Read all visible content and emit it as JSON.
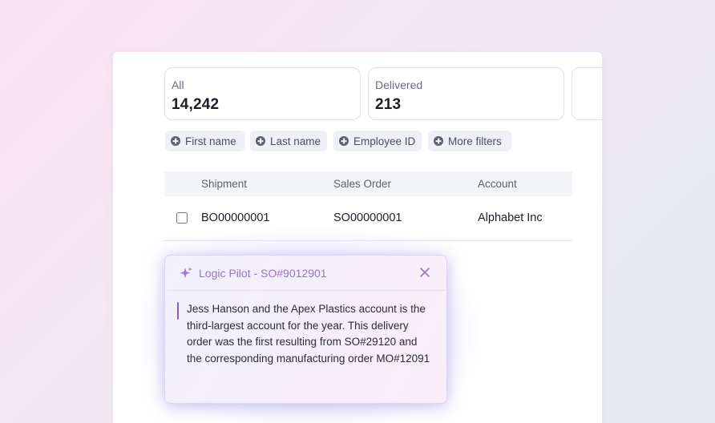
{
  "stats": [
    {
      "label": "All",
      "value": "14,242"
    },
    {
      "label": "Delivered",
      "value": "213"
    }
  ],
  "filters": [
    "First name",
    "Last name",
    "Employee ID",
    "More filters"
  ],
  "table": {
    "columns": [
      "Shipment",
      "Sales Order",
      "Account"
    ],
    "rows": [
      {
        "shipment": "BO00000001",
        "sales_order": "SO00000001",
        "account": "Alphabet Inc"
      }
    ]
  },
  "pilot": {
    "title": "Logic Pilot - SO#9012901",
    "message": "Jess Hanson and the Apex Plastics account is the third-largest account for the year. This delivery order was the first resulting from SO#29120 and the corresponding manufacturing order MO#12091",
    "accent": "#9a72c6"
  },
  "icons": [
    "plus-circle-icon",
    "sparkle-icon",
    "close-icon",
    "checkbox"
  ]
}
